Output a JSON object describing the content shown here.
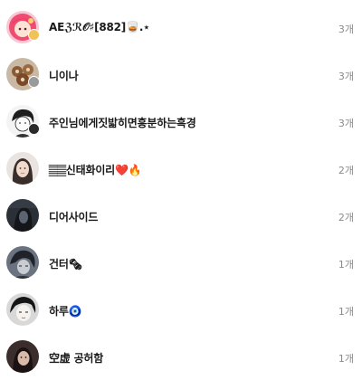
{
  "rows": [
    {
      "name": "AEℨℛ𝒪♯[882]🥃.⋆",
      "count": "3개",
      "avatar": "pink-hair-character-avatar"
    },
    {
      "name": "니이나",
      "count": "3개",
      "avatar": "food-photo-avatar"
    },
    {
      "name": "주인님에게짓밟히면흥분하는흑경",
      "count": "3개",
      "avatar": "manga-boy-avatar"
    },
    {
      "name": "𝄛𝄛신태화이리❤️🔥",
      "count": "2개",
      "avatar": "girl-photo-avatar"
    },
    {
      "name": "디어사이드",
      "count": "2개",
      "avatar": "dark-hooded-figure-avatar"
    },
    {
      "name": "건터🗞",
      "count": "1개",
      "avatar": "dark-anime-character-avatar"
    },
    {
      "name": "하루🧿",
      "count": "1개",
      "avatar": "anime-face-avatar"
    },
    {
      "name": "空虚 공허함",
      "count": "1개",
      "avatar": "dark-portrait-avatar"
    }
  ],
  "colors": {
    "name_text": "#1a1a1a",
    "count_text": "#8a8a8a",
    "badge": "#f0c35a"
  }
}
